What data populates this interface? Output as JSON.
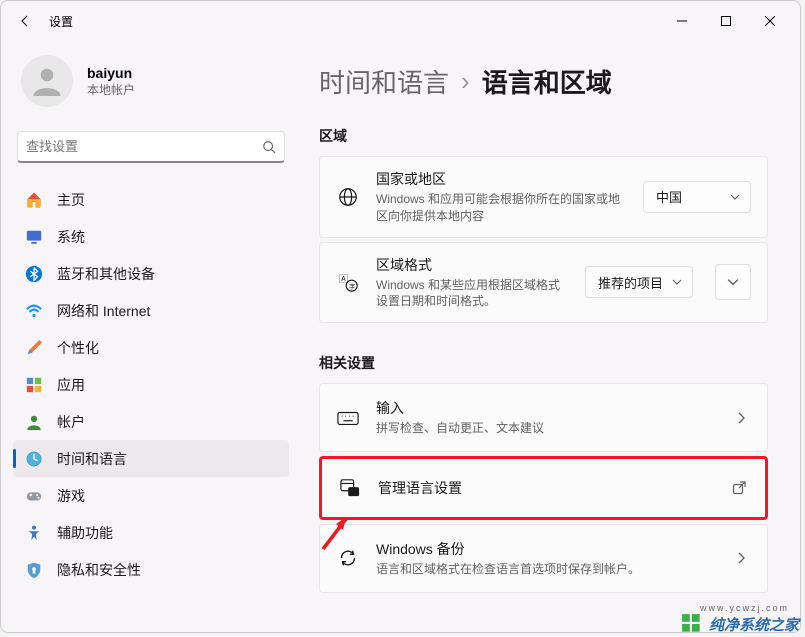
{
  "window_title": "设置",
  "profile": {
    "name": "baiyun",
    "subtitle": "本地帐户"
  },
  "search": {
    "placeholder": "查找设置"
  },
  "nav": [
    {
      "label": "主页"
    },
    {
      "label": "系统"
    },
    {
      "label": "蓝牙和其他设备"
    },
    {
      "label": "网络和 Internet"
    },
    {
      "label": "个性化"
    },
    {
      "label": "应用"
    },
    {
      "label": "帐户"
    },
    {
      "label": "时间和语言"
    },
    {
      "label": "游戏"
    },
    {
      "label": "辅助功能"
    },
    {
      "label": "隐私和安全性"
    }
  ],
  "breadcrumb": {
    "parent": "时间和语言",
    "current": "语言和区域"
  },
  "sections": {
    "region_h": "区域",
    "related_h": "相关设置"
  },
  "cards": {
    "country": {
      "title": "国家或地区",
      "desc": "Windows 和应用可能会根据你所在的国家或地区向你提供本地内容",
      "value": "中国"
    },
    "format": {
      "title": "区域格式",
      "desc": "Windows 和某些应用根据区域格式设置日期和时间格式。",
      "value": "推荐的项目"
    },
    "input": {
      "title": "输入",
      "desc": "拼写检查、自动更正、文本建议"
    },
    "admin": {
      "title": "管理语言设置"
    },
    "backup": {
      "title": "Windows 备份",
      "desc": "语言和区域格式在检查语言首选项时保存到帐户。"
    }
  },
  "watermark": {
    "brand": "纯净系统之家",
    "url": "www.ycwzj.com"
  }
}
